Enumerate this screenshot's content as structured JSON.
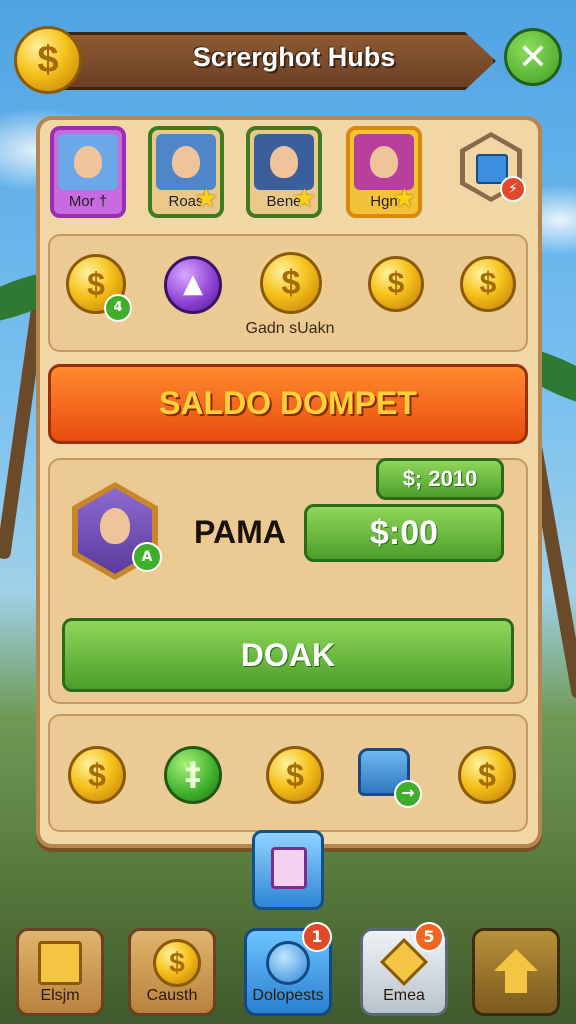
{
  "header": {
    "title": "Screrghot Hubs"
  },
  "characters": [
    {
      "name": "Mor",
      "mark": "†"
    },
    {
      "name": "Roas",
      "mark": "★"
    },
    {
      "name": "Bene",
      "mark": "★"
    },
    {
      "name": "Hgn",
      "mark": "★"
    }
  ],
  "gift": {
    "icon": "gift-box-icon"
  },
  "currency_row": {
    "badge": "4",
    "caption": "Gadn sUakn"
  },
  "banner": {
    "label": "SALDO DOMPET"
  },
  "player": {
    "badge": "A",
    "name": "PAMA",
    "top_value": "$; 2010",
    "balance": "$:00"
  },
  "action": {
    "label": "DOAK"
  },
  "bottom_row": {
    "icons": [
      "coin-icon",
      "plus-coin-icon",
      "coin-icon",
      "backpack-icon",
      "coin-icon"
    ]
  },
  "nav": [
    {
      "label": "Elsjm",
      "icon": "scroll-icon"
    },
    {
      "label": "Causth",
      "icon": "coin-icon"
    },
    {
      "label": "Dolopests",
      "icon": "globe-icon",
      "badge": "1"
    },
    {
      "label": "Emea",
      "icon": "sword-icon",
      "badge": "5"
    },
    {
      "label": "",
      "icon": "home-arrow-icon"
    }
  ]
}
